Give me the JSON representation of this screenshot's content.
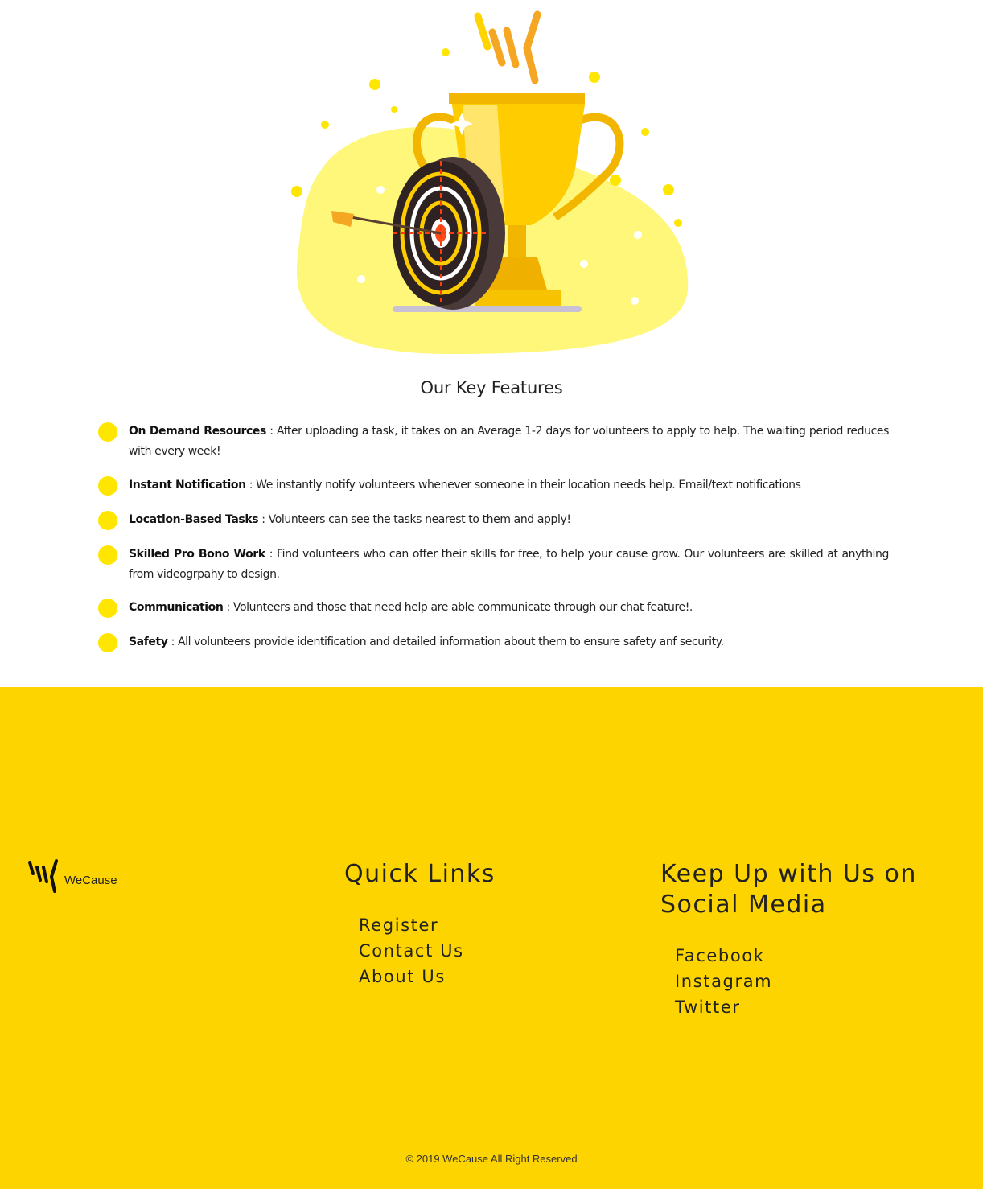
{
  "features": {
    "title": "Our Key Features",
    "items": [
      {
        "title": "On Demand Resources",
        "text": " : After uploading a task, it takes on an Average 1-2 days for volunteers to apply to help. The waiting period reduces with every week!"
      },
      {
        "title": "Instant Notification",
        "text": " : We instantly notify volunteers whenever someone in their location needs help. Email/text notifications"
      },
      {
        "title": "Location-Based Tasks",
        "text": " : Volunteers can see the tasks nearest to them and apply!"
      },
      {
        "title": "Skilled Pro Bono Work",
        "text": " : Find volunteers who can offer their skills for free, to help your cause grow. Our volunteers are skilled at anything from videogrpahy to design."
      },
      {
        "title": "Communication",
        "text": " : Volunteers and those that need help are able communicate through our chat feature!."
      },
      {
        "title": "Safety",
        "text": " : All volunteers provide identification and detailed information about them to ensure safety anf security."
      }
    ]
  },
  "footer": {
    "logo_text": "WeCause",
    "quick_links_title": "Quick Links",
    "quick_links": [
      "Register",
      "Contact Us",
      "About Us"
    ],
    "social_title": "Keep Up with Us on Social Media",
    "social_links": [
      "Facebook",
      "Instagram",
      "Twitter"
    ],
    "copyright": "© 2019 WeCause All Right Reserved"
  },
  "colors": {
    "accent": "#fdd400",
    "dot": "#ffe600"
  }
}
